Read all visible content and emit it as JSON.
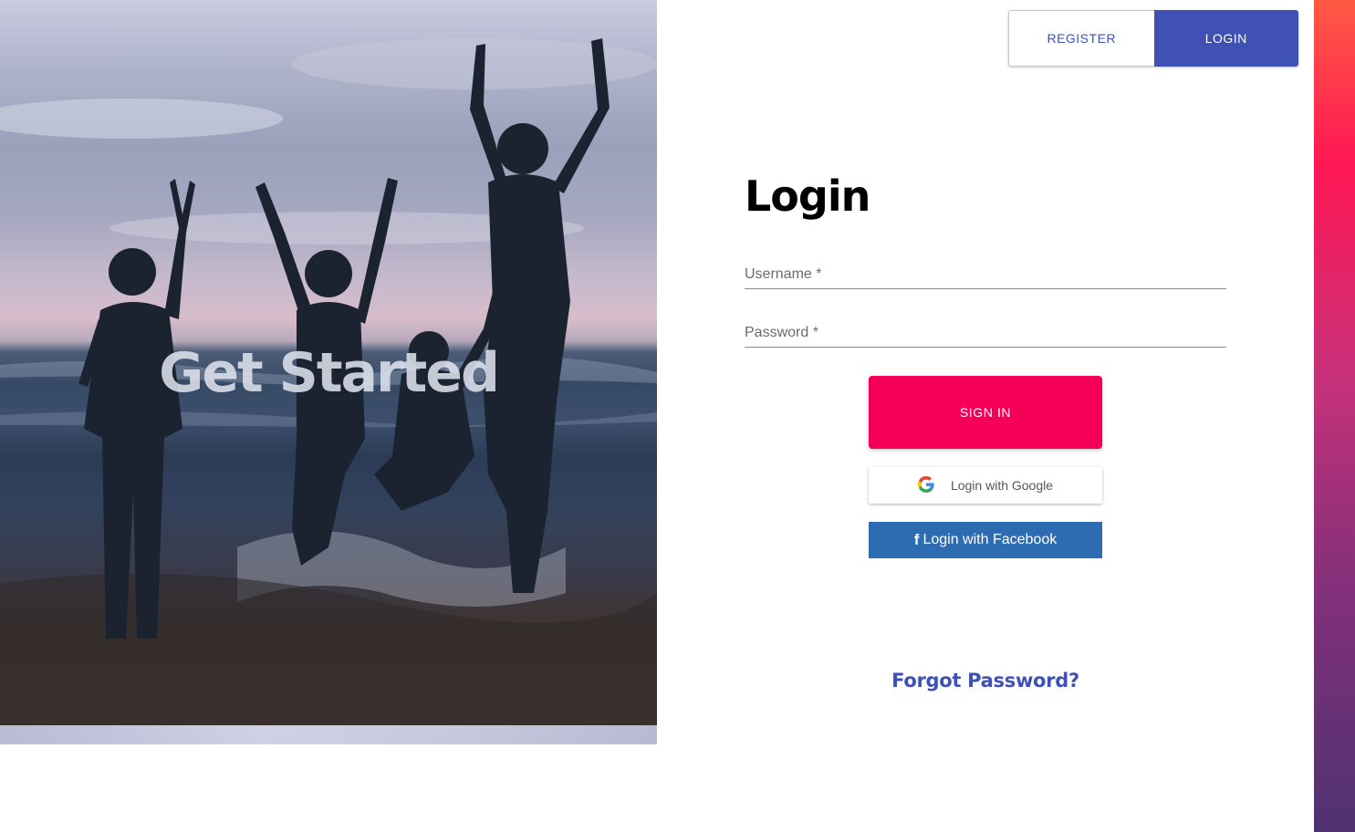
{
  "hero": {
    "title": "Get Started"
  },
  "toggle": {
    "register_label": "REGISTER",
    "login_label": "LOGIN"
  },
  "form": {
    "title": "Login",
    "username_label": "Username *",
    "password_label": "Password *",
    "sign_in_label": "SIGN IN",
    "google_label": "Login with Google",
    "facebook_label": "Login with Facebook",
    "forgot_label": "Forgot Password?"
  },
  "colors": {
    "primary": "#3f51b5",
    "accent": "#f50057",
    "facebook": "#2d6cb0"
  },
  "icons": {
    "google": "google-icon",
    "facebook": "facebook-icon"
  }
}
